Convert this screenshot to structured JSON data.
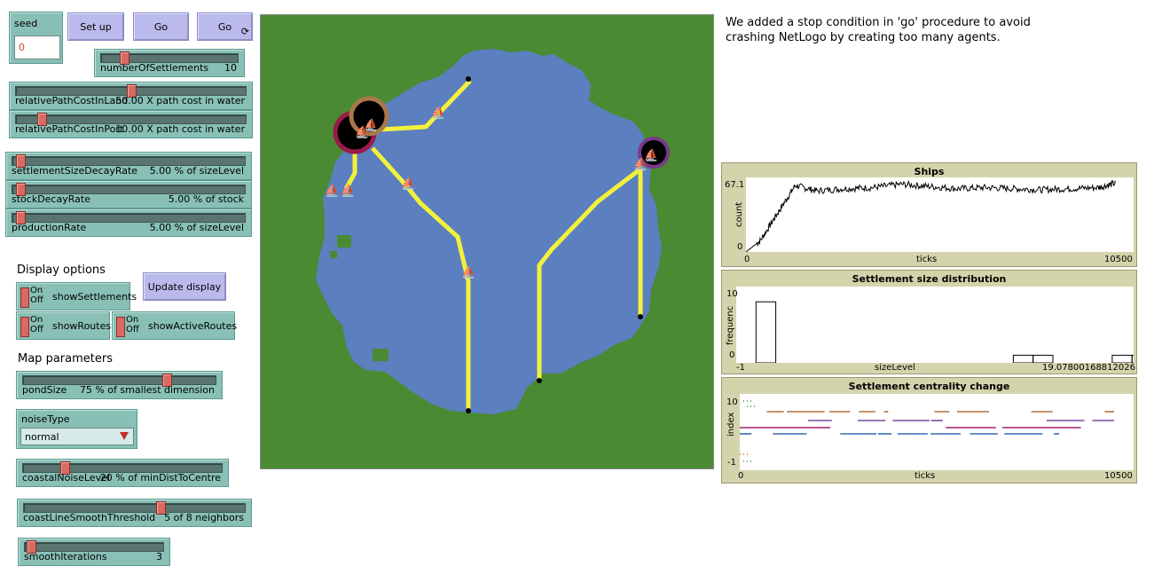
{
  "controls": {
    "seed": {
      "label": "seed",
      "value": "0"
    },
    "setup_button": "Set up",
    "go_once_button": "Go",
    "go_forever_button": "Go",
    "sliders": {
      "numberOfSettlements": {
        "label": "numberOfSettlements",
        "value": "10",
        "fraction": 0.15
      },
      "relativePathCostInLand": {
        "label": "relativePathCostInLand",
        "value": "50.00 X path cost in water",
        "fraction": 0.5
      },
      "relativePathCostInPort": {
        "label": "relativePathCostInPort",
        "value": "10.00 X path cost in water",
        "fraction": 0.1
      },
      "settlementSizeDecayRate": {
        "label": "settlementSizeDecayRate",
        "value": "5.00 % of sizeLevel",
        "fraction": 0.02
      },
      "stockDecayRate": {
        "label": "stockDecayRate",
        "value": "5.00 % of stock",
        "fraction": 0.02
      },
      "productionRate": {
        "label": "productionRate",
        "value": "5.00 % of sizeLevel",
        "fraction": 0.02
      },
      "pondSize": {
        "label": "pondSize",
        "value": "75 % of smallest dimension",
        "fraction": 0.75
      },
      "coastalNoiseLevel": {
        "label": "coastalNoiseLevel",
        "value": "20 % of minDistToCentre",
        "fraction": 0.2
      },
      "coastLineSmoothThreshold": {
        "label": "coastLineSmoothThreshold",
        "value": "5 of 8 neighbors",
        "fraction": 0.62
      },
      "smoothIterations": {
        "label": "smoothIterations",
        "value": "3",
        "fraction": 0.02
      }
    },
    "display_options_heading": "Display options",
    "switches": {
      "showSettlements": {
        "label": "showSettlements",
        "on": "On",
        "off": "Off"
      },
      "showRoutes": {
        "label": "showRoutes",
        "on": "On",
        "off": "Off"
      },
      "showActiveRoutes": {
        "label": "showActiveRoutes",
        "on": "On",
        "off": "Off"
      }
    },
    "update_display_button": "Update display",
    "map_parameters_heading": "Map parameters",
    "noiseType": {
      "label": "noiseType",
      "value": "normal"
    }
  },
  "note": "We added a stop condition in 'go' procedure to avoid crashing NetLogo by creating too many agents.",
  "colors": {
    "land": "#4a8a33",
    "water": "#5b7fbf",
    "route": "#f3f03c",
    "widget": "#88c0b6",
    "button": "#babaec",
    "plot_bg": "#d4d4ac"
  },
  "plots": {
    "ships": {
      "title": "Ships",
      "ylabel": "count",
      "xlabel": "ticks",
      "ymax": "67.1",
      "ymin": "0",
      "xmin": "0",
      "xmax": "10500"
    },
    "size_distribution": {
      "title": "Settlement size distribution",
      "ylabel": "frequenc",
      "xlabel": "sizeLevel",
      "ymax": "10",
      "ymin": "0",
      "xmin": "-1",
      "xmax": "19.07800168812026"
    },
    "centrality": {
      "title": "Settlement centrality change",
      "ylabel": "index",
      "xlabel": "ticks",
      "ymax": "10",
      "ymin": "-1",
      "xmin": "0",
      "xmax": "10500"
    }
  },
  "chart_data": [
    {
      "type": "line",
      "title": "Ships",
      "xlabel": "ticks",
      "ylabel": "count",
      "xlim": [
        0,
        10500
      ],
      "ylim": [
        0,
        67.1
      ],
      "series": [
        {
          "x": [
            0,
            400,
            900,
            1400,
            2000,
            2800,
            3600,
            4400,
            5200,
            6000,
            6800,
            7600,
            8400,
            9200,
            10000,
            10500
          ],
          "values": [
            0,
            10,
            35,
            60,
            55,
            57,
            58,
            61,
            59,
            57,
            58,
            57,
            56,
            57,
            58,
            62
          ]
        }
      ]
    },
    {
      "type": "bar",
      "title": "Settlement size distribution",
      "xlabel": "sizeLevel",
      "ylabel": "frequenc",
      "xlim": [
        -1,
        19.07800168812026
      ],
      "ylim": [
        0,
        10
      ],
      "series": [
        {
          "x": [
            0,
            1,
            13,
            14,
            18,
            19
          ],
          "values": [
            8,
            0,
            1,
            1,
            1,
            1
          ]
        }
      ]
    },
    {
      "type": "scatter",
      "title": "Settlement centrality change",
      "xlabel": "ticks",
      "ylabel": "index",
      "xlim": [
        0,
        10500
      ],
      "ylim": [
        -1,
        10
      ]
    }
  ]
}
